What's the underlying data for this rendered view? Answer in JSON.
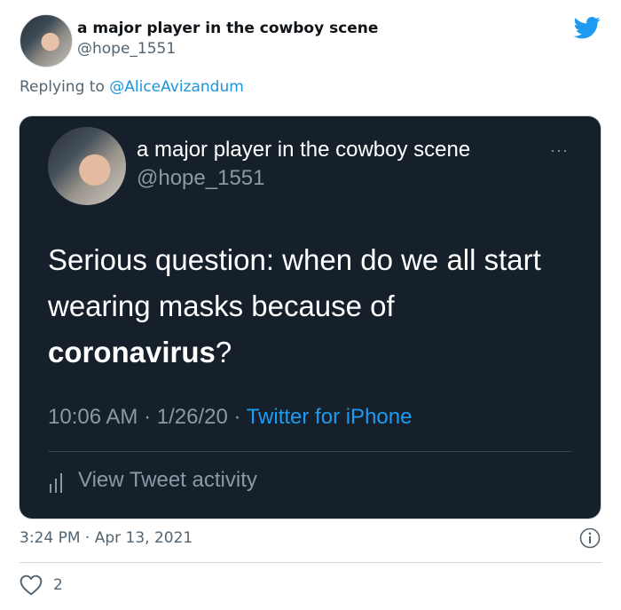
{
  "tweet": {
    "author_name": "a major player in the cowboy scene",
    "author_handle": "@hope_1551",
    "replying_prefix": "Replying to ",
    "replying_to": "@AliceAvizandum",
    "timestamp": "3:24 PM · Apr 13, 2021",
    "like_count": "2"
  },
  "embedded": {
    "author_name": "a major player in the cowboy scene",
    "author_handle": "@hope_1551",
    "more_label": "···",
    "text_part1": "Serious question: when do we all start wearing masks because of ",
    "text_bold": "coronavirus",
    "text_part2": "?",
    "time_date": "10:06 AM · 1/26/20 · ",
    "source": "Twitter for iPhone",
    "activity_label": "View Tweet activity"
  },
  "colors": {
    "accent": "#1d9bf0",
    "embed_background": "#15202b",
    "muted_text": "#536471"
  },
  "icons": [
    "twitter-bird-icon",
    "activity-chart-icon",
    "info-icon",
    "heart-icon"
  ]
}
